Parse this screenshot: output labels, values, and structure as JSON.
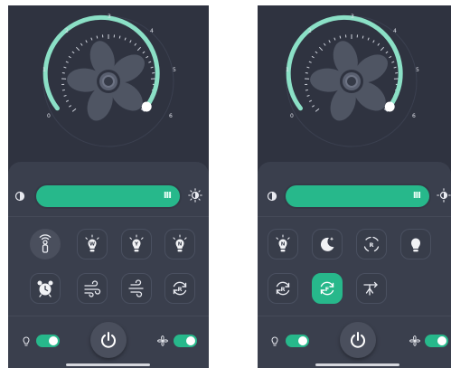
{
  "dial_labels": [
    "0",
    "1",
    "2",
    "3",
    "4",
    "5",
    "6"
  ],
  "colors": {
    "accent": "#27b88b",
    "background": "#2f3340",
    "panel": "#3a3f4d"
  },
  "left_screen": {
    "slider_grip": "III",
    "row1": [
      "remote-icon",
      "bulb-w-icon",
      "bulb-y-icon",
      "bulb-n-icon"
    ],
    "row2": [
      "alarm-clock-icon",
      "wind-icon",
      "breeze-icon",
      "reverse-r-icon"
    ],
    "toggles": {
      "light": true,
      "fan": true
    }
  },
  "right_screen": {
    "slider_grip": "III",
    "row1": [
      "bulb-n-icon",
      "moon-star-icon",
      "cycle-r-icon",
      "bulb-icon"
    ],
    "row2": [
      "reverse-r-icon",
      "reverse-f-icon",
      "timer-arrow-icon"
    ],
    "active_button": "reverse-f-icon",
    "toggles": {
      "light": true,
      "fan": true
    }
  }
}
